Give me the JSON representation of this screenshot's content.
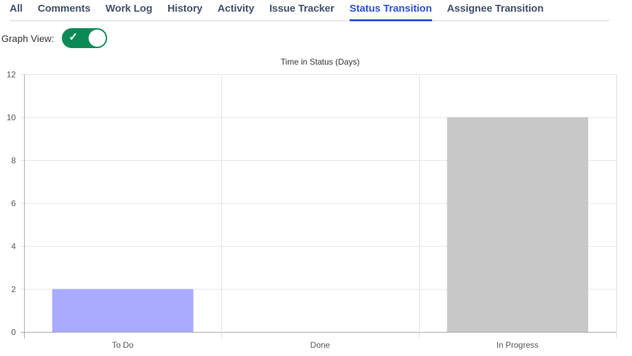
{
  "tabs": [
    {
      "label": "All"
    },
    {
      "label": "Comments"
    },
    {
      "label": "Work Log"
    },
    {
      "label": "History"
    },
    {
      "label": "Activity"
    },
    {
      "label": "Issue Tracker"
    },
    {
      "label": "Status Transition",
      "active": true
    },
    {
      "label": "Assignee Transition"
    }
  ],
  "graph_view": {
    "label": "Graph View:",
    "enabled": true,
    "color": "#0c8a55"
  },
  "chart_data": {
    "type": "bar",
    "title": "Time in Status (Days)",
    "categories": [
      "To Do",
      "Done",
      "In Progress"
    ],
    "values": [
      2,
      0,
      10
    ],
    "colors": [
      "#aaaaff",
      "#aaaaff",
      "#c8c8c8"
    ],
    "ylim": [
      0,
      12
    ],
    "yticks": [
      0,
      2,
      4,
      6,
      8,
      10,
      12
    ],
    "xlabel": "",
    "ylabel": "",
    "grid": true
  }
}
